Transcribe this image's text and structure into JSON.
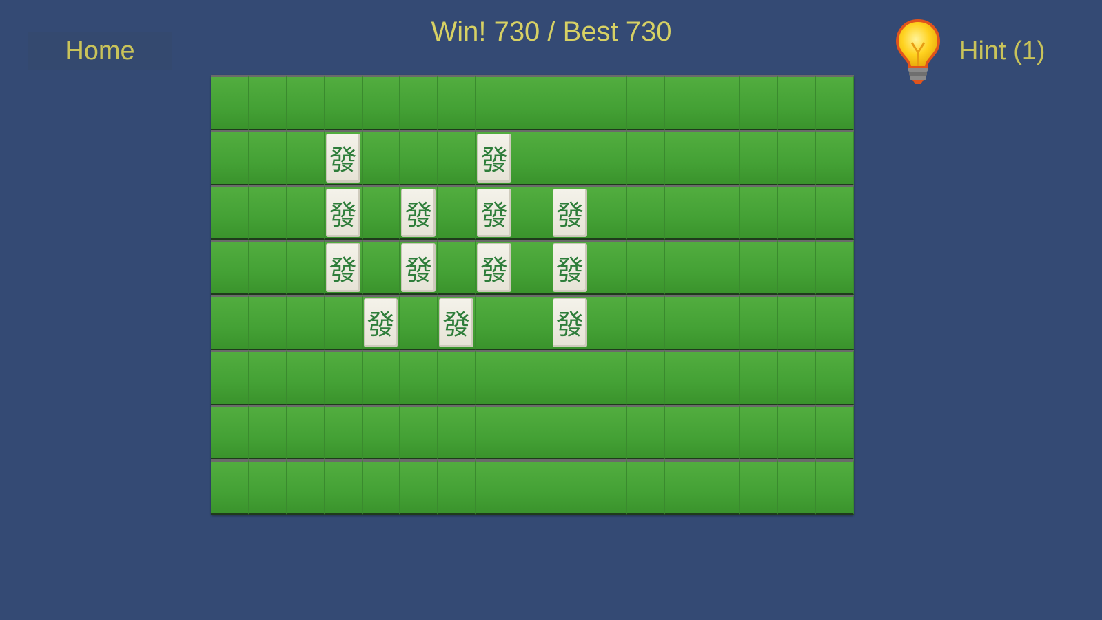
{
  "header": {
    "home_label": "Home",
    "score_text": "Win! 730 / Best 730",
    "hint_label": "Hint (1)",
    "hint_icon": "lightbulb-icon"
  },
  "board": {
    "rows": 8,
    "cols": 17,
    "tile_glyph": "發",
    "tiles": [
      {
        "row": 1,
        "col": 3
      },
      {
        "row": 1,
        "col": 7
      },
      {
        "row": 2,
        "col": 3
      },
      {
        "row": 2,
        "col": 5
      },
      {
        "row": 2,
        "col": 7
      },
      {
        "row": 2,
        "col": 9
      },
      {
        "row": 3,
        "col": 3
      },
      {
        "row": 3,
        "col": 5
      },
      {
        "row": 3,
        "col": 7
      },
      {
        "row": 3,
        "col": 9
      },
      {
        "row": 4,
        "col": 4
      },
      {
        "row": 4,
        "col": 6
      },
      {
        "row": 4,
        "col": 9
      }
    ]
  },
  "colors": {
    "background": "#344a74",
    "felt": "#44a135",
    "text_accent": "#d7d164",
    "tile_face": "#f0eee4",
    "tile_glyph": "#2e7d3a"
  }
}
